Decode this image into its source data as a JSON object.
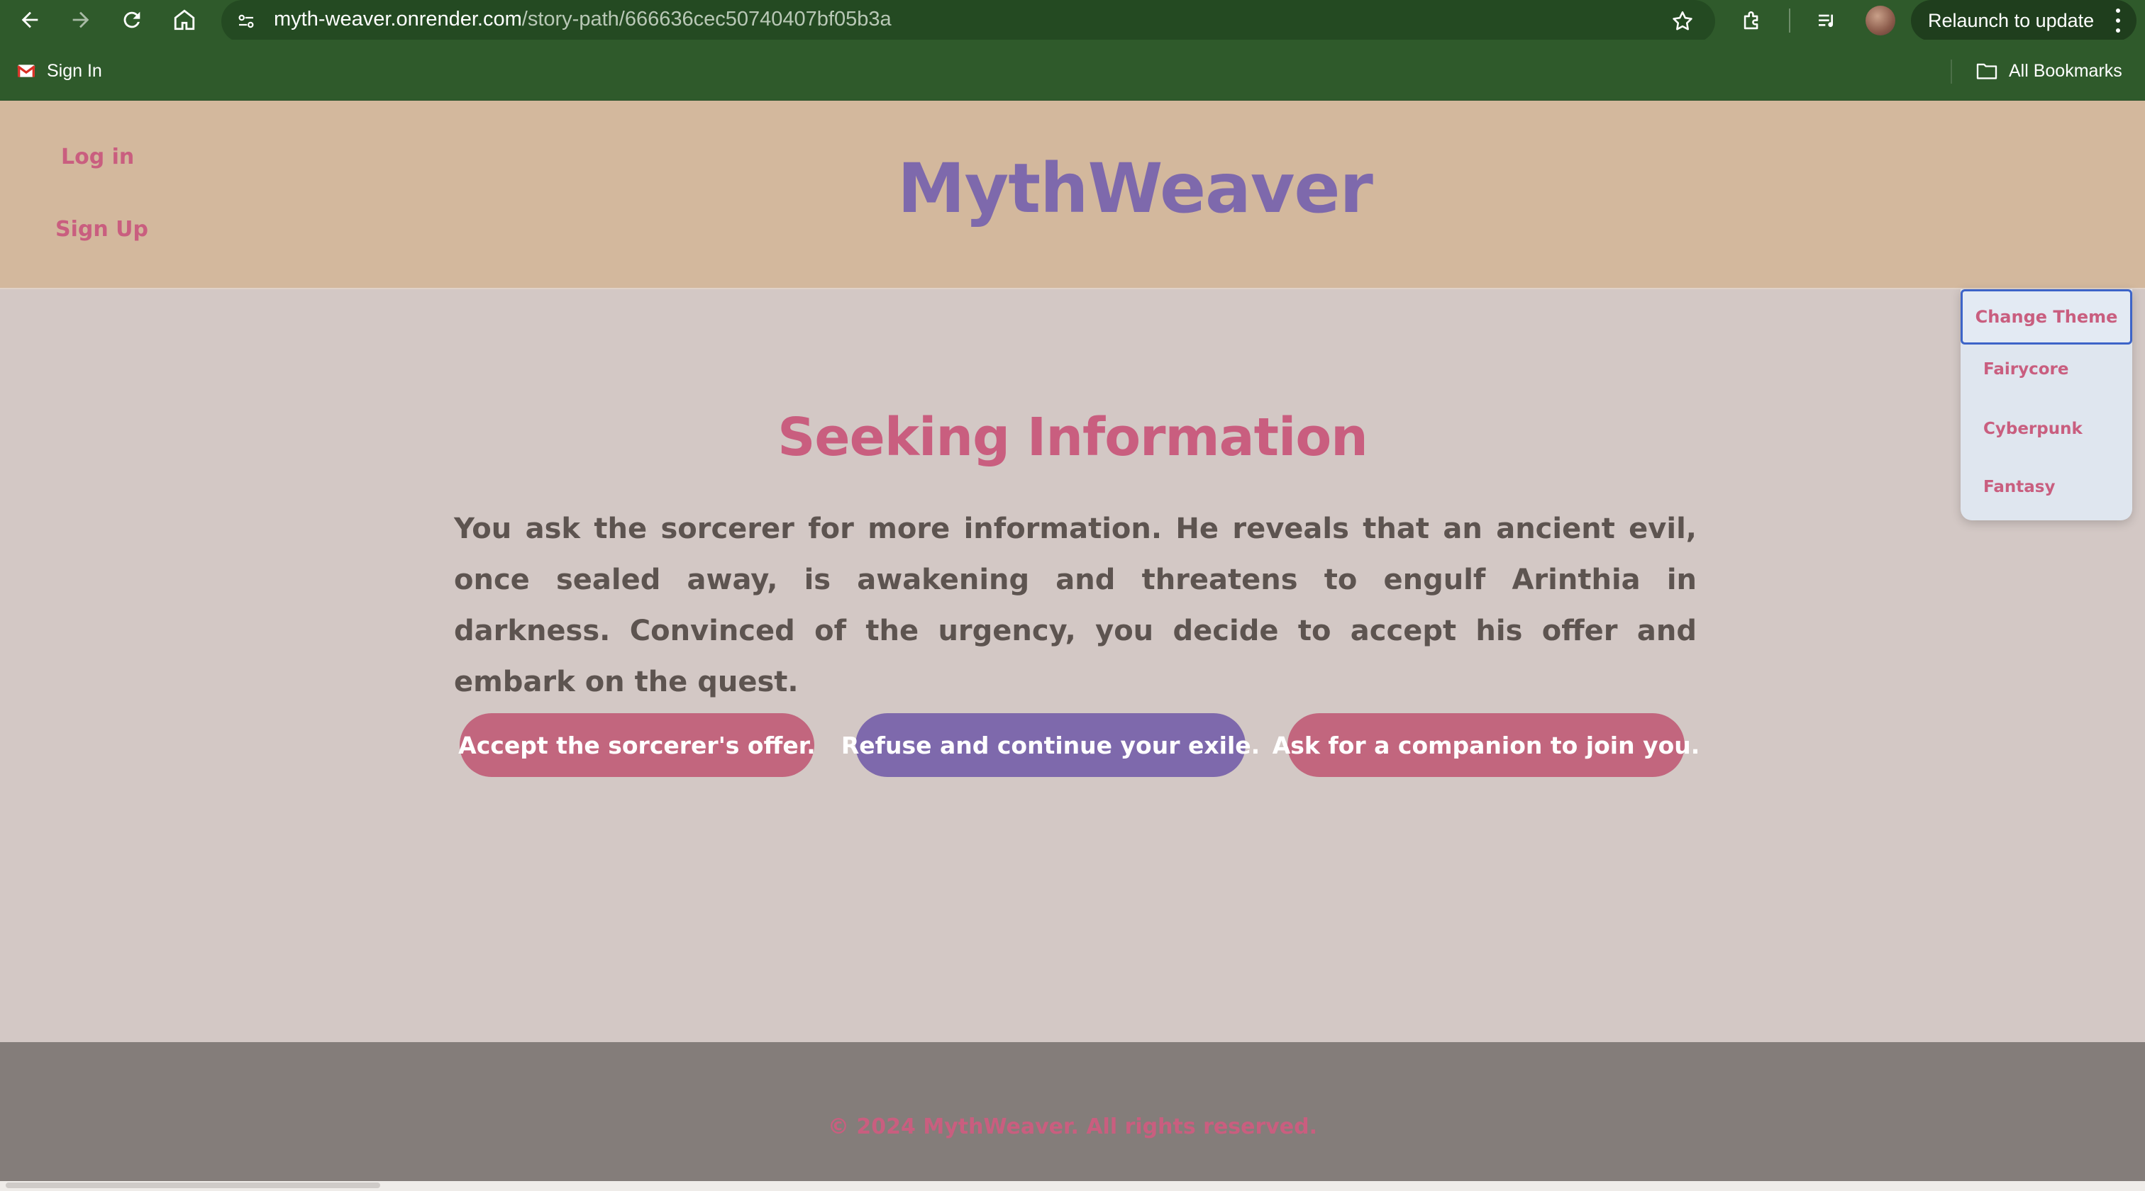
{
  "browser": {
    "url_host": "myth-weaver.onrender.com",
    "url_path": "/story-path/666636cec50740407bf05b3a",
    "relaunch_label": "Relaunch to update",
    "bookmarks": [
      {
        "label": "Sign In",
        "icon": "gmail-icon"
      }
    ],
    "all_bookmarks_label": "All Bookmarks"
  },
  "header": {
    "logo": "MythWeaver",
    "login_label": "Log in",
    "signup_label": "Sign Up"
  },
  "theme_menu": {
    "button_label": "Change Theme",
    "options": [
      "Fairycore",
      "Cyberpunk",
      "Fantasy"
    ]
  },
  "story": {
    "title": "Seeking Information",
    "text": "You ask the sorcerer for more information. He reveals that an ancient evil, once sealed away, is awakening and threatens to engulf Arinthia in darkness. Convinced of the urgency, you decide to accept his offer and embark on the quest.",
    "choices": [
      {
        "label": "Accept the sorcerer's offer."
      },
      {
        "label": "Refuse and continue your exile."
      },
      {
        "label": "Ask for a companion to join you."
      }
    ]
  },
  "footer": {
    "text": "© 2024 MythWeaver. All rights reserved."
  },
  "colors": {
    "browser_green": "#2f5a2b",
    "header_tan": "#d3b89d",
    "main_bg": "#d3c8c5",
    "accent_pink": "#c95e7f",
    "accent_purple": "#7e69ac",
    "footer_gray": "#847d7a"
  }
}
